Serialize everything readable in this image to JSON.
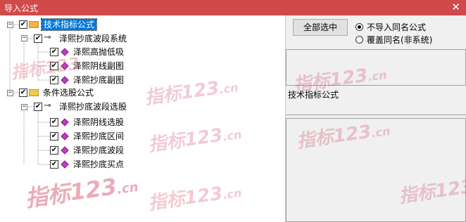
{
  "window": {
    "title": "导入公式",
    "close_glyph": "✕"
  },
  "tree": {
    "nodes": [
      {
        "label": "技术指标公式",
        "checked": true,
        "expanded": true,
        "icon": "folder-icon",
        "selected": true
      },
      {
        "label": "泽熙抄底波段系统",
        "checked": true,
        "expanded": true,
        "icon": "key-icon"
      },
      {
        "label": "泽熙高抛低吸",
        "checked": true,
        "icon": "formula-diamond-icon"
      },
      {
        "label": "泽熙阴线副图",
        "checked": true,
        "icon": "formula-diamond-icon"
      },
      {
        "label": "泽熙抄底副图",
        "checked": true,
        "icon": "formula-diamond-icon"
      },
      {
        "label": "条件选股公式",
        "checked": true,
        "expanded": true,
        "icon": "folder-icon"
      },
      {
        "label": "泽熙抄底波段选股",
        "checked": true,
        "expanded": true,
        "icon": "key-icon"
      },
      {
        "label": "泽熙阴线选股",
        "checked": true,
        "icon": "formula-diamond-icon"
      },
      {
        "label": "泽熙抄底区间",
        "checked": true,
        "icon": "formula-diamond-icon"
      },
      {
        "label": "泽熙抄底波段",
        "checked": true,
        "icon": "formula-diamond-icon"
      },
      {
        "label": "泽熙抄底买点",
        "checked": true,
        "icon": "formula-diamond-icon"
      }
    ],
    "expand_glyph": "−",
    "check_glyph": "✔"
  },
  "controls": {
    "select_all_label": "全部选中",
    "radio_options": [
      {
        "label": "不导入同名公式",
        "checked": true
      },
      {
        "label": "覆盖同名(非系统)",
        "checked": false
      }
    ]
  },
  "detail": {
    "label": "技术指标公式"
  },
  "watermark": {
    "text": "指标123",
    "suffix": ".cn"
  }
}
